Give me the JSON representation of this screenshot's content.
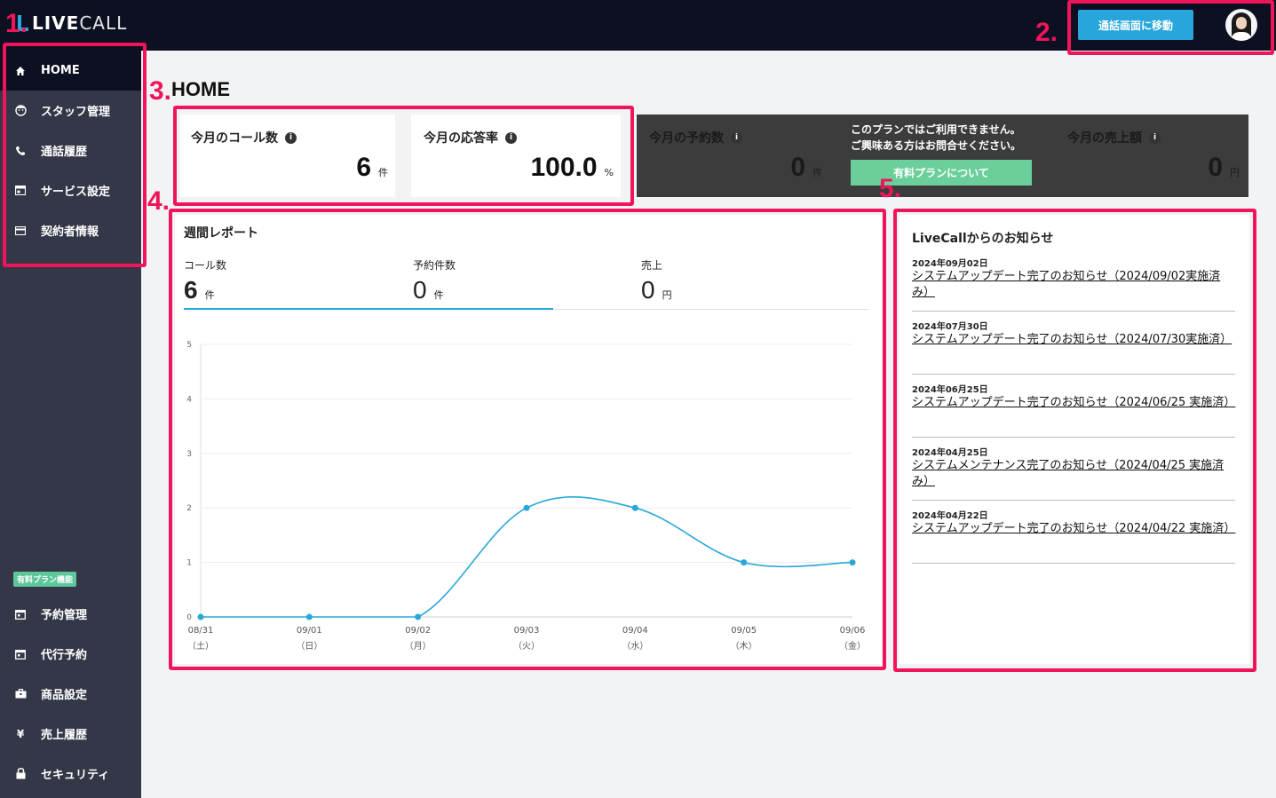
{
  "app": {
    "logo_bold": "LIVE",
    "logo_light": "CALL"
  },
  "header": {
    "goto_call_label": "通話画面に移動"
  },
  "sidebar": {
    "items": [
      {
        "label": "HOME",
        "icon": "home-icon"
      },
      {
        "label": "スタッフ管理",
        "icon": "staff-icon"
      },
      {
        "label": "通話履歴",
        "icon": "phone-icon"
      },
      {
        "label": "サービス設定",
        "icon": "service-icon"
      },
      {
        "label": "契約者情報",
        "icon": "card-icon"
      }
    ],
    "paid_badge": "有料プラン機能",
    "paid_items": [
      {
        "label": "予約管理",
        "icon": "calendar-icon"
      },
      {
        "label": "代行予約",
        "icon": "calendar-icon"
      },
      {
        "label": "商品設定",
        "icon": "briefcase-icon"
      },
      {
        "label": "売上履歴",
        "icon": "yen-icon"
      },
      {
        "label": "セキュリティ",
        "icon": "lock-icon"
      }
    ]
  },
  "annotations": [
    "1.",
    "2.",
    "3.",
    "4.",
    "5."
  ],
  "page_title": "HOME",
  "stats": {
    "calls": {
      "label": "今月のコール数",
      "value": "6",
      "unit": "件"
    },
    "answer_rate": {
      "label": "今月の応答率",
      "value": "100.0",
      "unit": "%"
    },
    "reservations": {
      "label": "今月の予約数",
      "value": "0",
      "unit": "件"
    },
    "sales": {
      "label": "今月の売上額",
      "value": "0",
      "unit": "円"
    }
  },
  "plan_notice": {
    "message_line1": "このプランではご利用できません。",
    "message_line2": "ご興味ある方はお問合せください。",
    "button": "有料プランについて"
  },
  "report": {
    "title": "週間レポート",
    "metrics": [
      {
        "label": "コール数",
        "value": "6",
        "unit": "件"
      },
      {
        "label": "予約件数",
        "value": "0",
        "unit": "件"
      },
      {
        "label": "売上",
        "value": "0",
        "unit": "円"
      }
    ]
  },
  "chart_data": {
    "type": "line",
    "categories": [
      "08/31",
      "09/01",
      "09/02",
      "09/03",
      "09/04",
      "09/05",
      "09/06"
    ],
    "day_labels": [
      "（土）",
      "（日）",
      "（月）",
      "（火）",
      "（水）",
      "（木）",
      "（金）"
    ],
    "values": [
      0,
      0,
      0,
      2,
      2,
      1,
      1
    ],
    "ylim": [
      0,
      5
    ],
    "yticks": [
      0,
      1,
      2,
      3,
      4,
      5
    ],
    "color": "#29a8d8",
    "grid": true
  },
  "news": {
    "title": "LiveCallからのお知らせ",
    "items": [
      {
        "date": "2024年09月02日",
        "text": "システムアップデート完了のお知らせ（2024/09/02実施済み）"
      },
      {
        "date": "2024年07月30日",
        "text": "システムアップデート完了のお知らせ（2024/07/30実施済）"
      },
      {
        "date": "2024年06月25日",
        "text": "システムアップデート完了のお知らせ（2024/06/25 実施済）"
      },
      {
        "date": "2024年04月25日",
        "text": "システムメンテナンス完了のお知らせ（2024/04/25 実施済み）"
      },
      {
        "date": "2024年04月22日",
        "text": "システムアップデート完了のお知らせ（2024/04/22 実施済）"
      }
    ]
  }
}
